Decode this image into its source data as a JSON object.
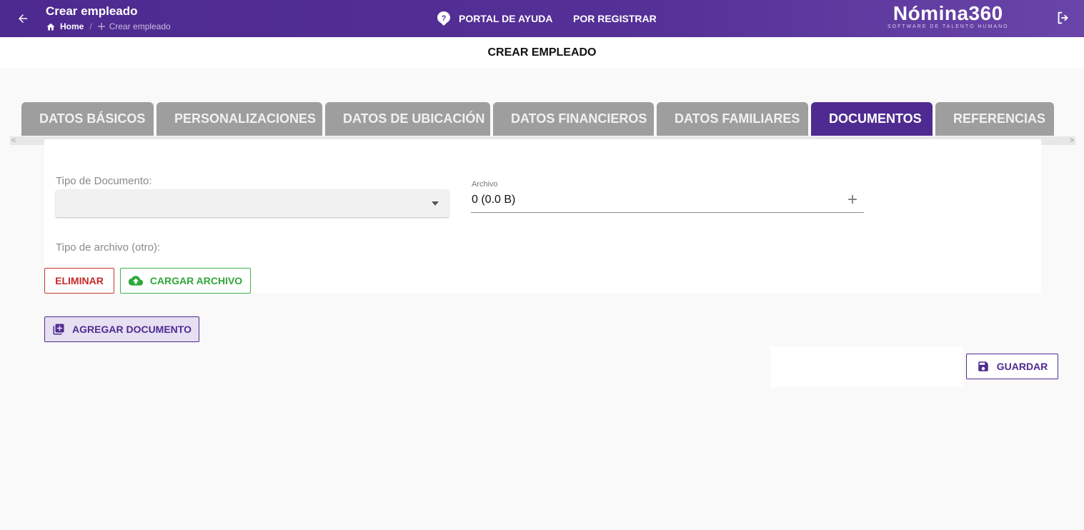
{
  "header": {
    "title": "Crear empleado",
    "breadcrumb": {
      "home": "Home",
      "separator": "/",
      "current": "Crear empleado"
    },
    "help_label": "PORTAL DE AYUDA",
    "register_label": "POR REGISTRAR",
    "logo": {
      "name": "Nómina360",
      "tagline": "SOFTWARE DE TALENTO HUMANO"
    }
  },
  "page": {
    "heading": "CREAR EMPLEADO"
  },
  "tabs": [
    {
      "label": "DATOS BÁSICOS",
      "active": false
    },
    {
      "label": "PERSONALIZACIONES",
      "active": false
    },
    {
      "label": "DATOS DE UBICACIÓN",
      "active": false
    },
    {
      "label": "DATOS FINANCIEROS",
      "active": false
    },
    {
      "label": "DATOS FAMILIARES",
      "active": false
    },
    {
      "label": "DOCUMENTOS",
      "active": true
    },
    {
      "label": "REFERENCIAS",
      "active": false
    }
  ],
  "scroll": {
    "left": "<",
    "right": ">"
  },
  "form": {
    "doc_type_label": "Tipo de Documento:",
    "doc_type_value": "",
    "file_label": "Archivo",
    "file_value": "0 (0.0 B)",
    "file_add": "+",
    "other_type_label": "Tipo de archivo (otro):"
  },
  "buttons": {
    "delete": "ELIMINAR",
    "upload": "CARGAR ARCHIVO",
    "add_document": "AGREGAR DOCUMENTO",
    "save": "GUARDAR"
  },
  "colors": {
    "brand": "#4f2b91",
    "tab_inactive": "#9e9e9e",
    "danger": "#c62828",
    "success": "#2fa63b"
  },
  "icons": [
    "arrow-left-icon",
    "home-icon",
    "plus-icon",
    "help-icon",
    "logout-icon",
    "cloud-upload-icon",
    "library-add-icon",
    "save-icon",
    "dropdown-caret-icon"
  ]
}
